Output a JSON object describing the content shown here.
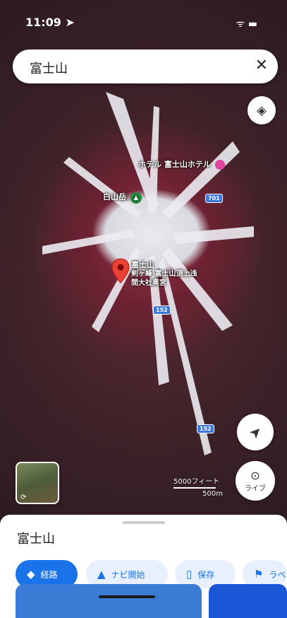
{
  "status_bar": {
    "time": "11:09 ➤",
    "indicators": "ᯤ ▬"
  },
  "search": {
    "query": "富士山"
  },
  "map": {
    "labels": {
      "hotel": "ホテル 富士山ホテル",
      "hut": "白山岳",
      "summit_line1": "富士山",
      "summit_line2": "剣ヶ峰 富士山頂上浅間大社奥宮"
    },
    "road_badges": [
      "701",
      "152",
      "152"
    ],
    "scale": {
      "distance": "5000フィート",
      "metric": "500m"
    },
    "live_label": "ライブ"
  },
  "sheet": {
    "title": "富士山",
    "chips": [
      {
        "label": "経路",
        "icon": "directions-icon"
      },
      {
        "label": "ナビ開始",
        "icon": "navigation-arrow-icon"
      },
      {
        "label": "保存",
        "icon": "bookmark-icon"
      },
      {
        "label": "ラベル",
        "icon": "flag-icon"
      }
    ]
  },
  "colors": {
    "accent": "#1a73e8",
    "chip_bg": "#e8f0fe",
    "pin": "#ea4335",
    "sheet_bg": "#ffffff"
  }
}
